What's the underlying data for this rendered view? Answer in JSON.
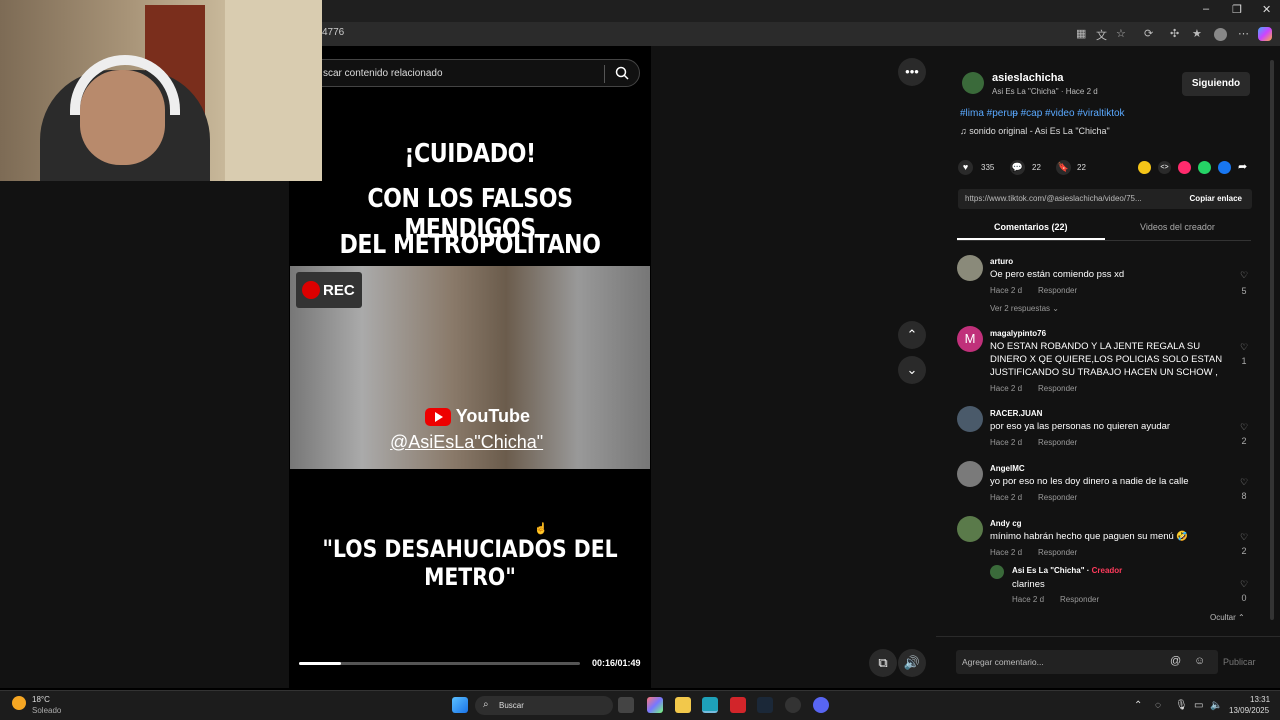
{
  "browser": {
    "url_fragment": "4776",
    "win_controls": [
      "–",
      "❐",
      "✕"
    ]
  },
  "search": {
    "placeholder": "scar contenido relacionado"
  },
  "video": {
    "title_lines": [
      "¡CUIDADO!",
      "CON LOS FALSOS MENDIGOS",
      "DEL METROPOLITANO"
    ],
    "rec_label": "REC",
    "youtube_label": "YouTube",
    "handle": "@AsiEsLa\"Chicha\"",
    "bottom_title": "\"LOS DESAHUCIADOS DEL METRO\"",
    "time": "00:16/01:49",
    "progress": 0.15
  },
  "post": {
    "author": "asieslachicha",
    "author_sub": "Asi Es La \"Chicha\" · Hace 2 d",
    "follow_label": "Siguiendo",
    "tags": "#lima #peruᵽ #cap #video #viraltiktok",
    "sound": "sonido original - Asi Es La \"Chicha\"",
    "likes": "335",
    "comments": "22",
    "saves": "22",
    "link": "https://www.tiktok.com/@asieslachicha/video/75...",
    "copy_label": "Copiar enlace"
  },
  "tabs": {
    "comments": "Comentarios (22)",
    "creator_videos": "Videos del creador"
  },
  "comments": [
    {
      "user": "arturo",
      "text": "Oe pero están comiendo pss xd",
      "meta": "Hace 2 d",
      "reply": "Responder",
      "likes": "5",
      "more": "Ver 2 respuestas ⌄"
    },
    {
      "user": "magalypinto76",
      "text": "NO ESTAN ROBANDO Y LA JENTE REGALA SU DINERO X QE QUIERE,LOS POLICIAS SOLO ESTAN JUSTIFICANDO SU TRABAJO HACEN UN SCHOW ,",
      "meta": "Hace 2 d",
      "reply": "Responder",
      "likes": "1",
      "avatar_letter": "M"
    },
    {
      "user": "RACER.JUAN",
      "text": "por eso ya las personas no quieren ayudar",
      "meta": "Hace 2 d",
      "reply": "Responder",
      "likes": "2"
    },
    {
      "user": "AngelMC",
      "text": "yo por eso no les doy dinero a nadie de la calle",
      "meta": "Hace 2 d",
      "reply": "Responder",
      "likes": "8"
    },
    {
      "user": "Andy cg",
      "text": "mínimo habrán hecho que paguen su menú 🤣",
      "meta": "Hace 2 d",
      "reply": "Responder",
      "likes": "2"
    }
  ],
  "reply": {
    "user": "Asi Es La \"Chicha\"",
    "badge": "Creador",
    "sep": " · ",
    "text": "clarines",
    "meta": "Hace 2 d",
    "reply": "Responder",
    "likes": "0"
  },
  "hide_label": "Ocultar ⌃",
  "composer": {
    "placeholder": "Agregar comentario...",
    "publish": "Publicar"
  },
  "taskbar": {
    "temp": "18°C",
    "weather": "Soleado",
    "search": "Buscar",
    "time": "13:31",
    "date": "13/09/2025"
  }
}
